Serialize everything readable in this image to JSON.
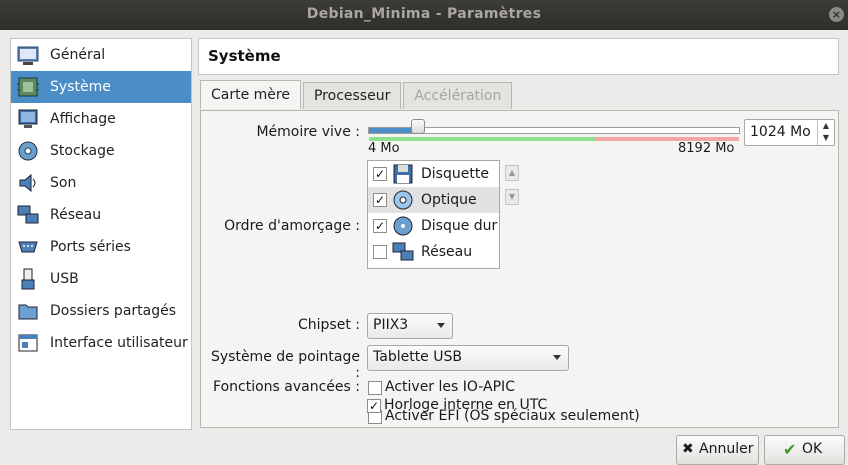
{
  "window": {
    "title": "Debian_Minima - Paramètres",
    "close_glyph": "×"
  },
  "sidebar": {
    "items": [
      {
        "label": "Général",
        "icon": "general-icon"
      },
      {
        "label": "Système",
        "icon": "system-icon",
        "selected": true
      },
      {
        "label": "Affichage",
        "icon": "display-icon"
      },
      {
        "label": "Stockage",
        "icon": "storage-icon"
      },
      {
        "label": "Son",
        "icon": "audio-icon"
      },
      {
        "label": "Réseau",
        "icon": "network-icon"
      },
      {
        "label": "Ports séries",
        "icon": "serial-ports-icon"
      },
      {
        "label": "USB",
        "icon": "usb-icon"
      },
      {
        "label": "Dossiers partagés",
        "icon": "shared-folders-icon"
      },
      {
        "label": "Interface utilisateur",
        "icon": "user-interface-icon"
      }
    ]
  },
  "panel": {
    "title": "Système"
  },
  "tabs": [
    {
      "label": "Carte mère",
      "active": true
    },
    {
      "label": "Processeur"
    },
    {
      "label": "Accélération",
      "disabled": true
    }
  ],
  "motherboard": {
    "memory": {
      "label": "Mémoire vive :",
      "min_label": "4 Mo",
      "max_label": "8192 Mo",
      "value": "1024 Mo",
      "fraction": 0.125
    },
    "boot_order": {
      "label": "Ordre d'amorçage :",
      "items": [
        {
          "label": "Disquette",
          "checked": true,
          "icon": "floppy-icon"
        },
        {
          "label": "Optique",
          "checked": true,
          "icon": "optical-disc-icon",
          "selected": true
        },
        {
          "label": "Disque dur",
          "checked": true,
          "icon": "hard-disk-icon"
        },
        {
          "label": "Réseau",
          "checked": false,
          "icon": "network-boot-icon"
        }
      ]
    },
    "chipset": {
      "label": "Chipset :",
      "value": "PIIX3"
    },
    "pointing": {
      "label": "Système de pointage :",
      "value": "Tablette USB"
    },
    "extended": {
      "label": "Fonctions avancées :",
      "options": [
        {
          "label": "Activer les IO-APIC",
          "checked": false
        },
        {
          "label": "Activer EFI (OS spéciaux seulement)",
          "checked": false
        },
        {
          "label": "Horloge interne en UTC",
          "checked": true
        }
      ]
    }
  },
  "buttons": {
    "cancel": "Annuler",
    "ok": "OK"
  },
  "colors": {
    "accent": "#4a8dc7",
    "slider_green": "#7fd17f",
    "slider_red": "#f09a9a"
  }
}
